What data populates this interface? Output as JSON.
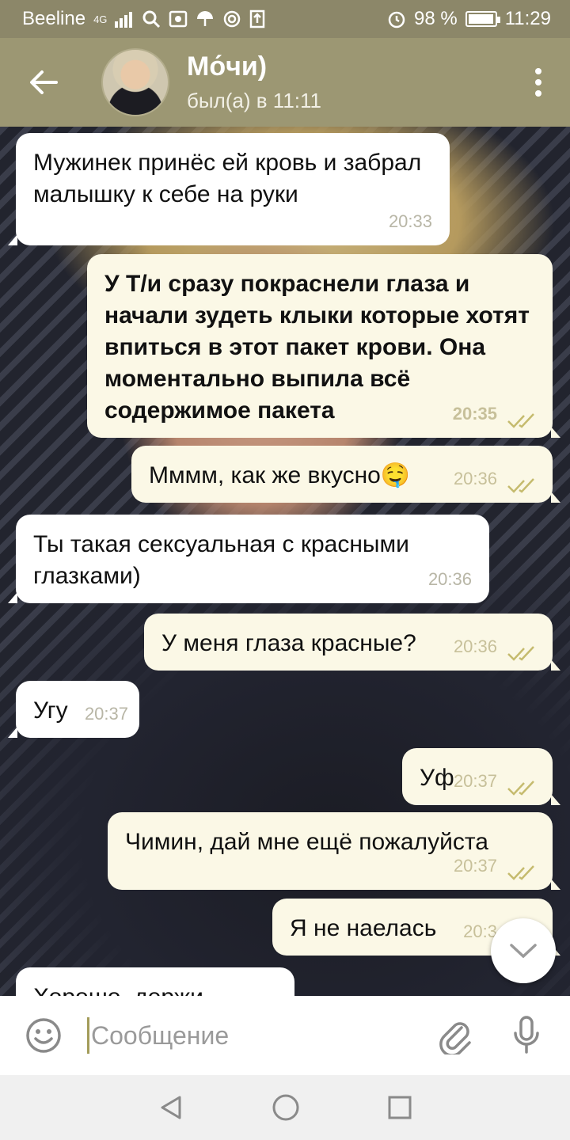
{
  "status_bar": {
    "carrier": "Beeline",
    "network": "4G",
    "battery": "98 %",
    "battery_level": 0.98,
    "time": "11:29"
  },
  "header": {
    "name": "Мо́чи)",
    "status": "был(а) в 11:11"
  },
  "messages": [
    {
      "dir": "in",
      "text": "Мужинек принёс ей кровь и забрал малышку к себе на руки",
      "time": "20:33"
    },
    {
      "dir": "out",
      "text": "У Т/и сразу покраснели глаза и начали зудеть клыки которые хотят впиться в этот пакет крови. Она моментально выпила всё содержимое пакета",
      "time": "20:35"
    },
    {
      "dir": "out",
      "text": "Мммм, как же вкусно🤤",
      "time": "20:36"
    },
    {
      "dir": "in",
      "text": "Ты такая сексуальная с красными глазками)",
      "time": "20:36"
    },
    {
      "dir": "out",
      "text": "У меня глаза красные?",
      "time": "20:36"
    },
    {
      "dir": "in",
      "text": "Угу",
      "time": "20:37"
    },
    {
      "dir": "out",
      "text": "Уф",
      "time": "20:37"
    },
    {
      "dir": "out",
      "text": "Чимин, дай мне ещё пожалуйста",
      "time": "20:37"
    },
    {
      "dir": "out",
      "text": "Я не наелась",
      "time": "20:3"
    },
    {
      "dir": "in",
      "text": "Хорошо, держи",
      "time": ""
    }
  ],
  "input": {
    "placeholder": "Сообщение"
  },
  "colors": {
    "header": "#9c9773",
    "status_bar": "#8c8769",
    "bubble_in": "#ffffff",
    "bubble_out": "#fbf8e6",
    "read_ticks": "#c5bb6e"
  },
  "icons": [
    "back-arrow-icon",
    "more-vert-icon",
    "double-check-icon",
    "chevron-down-icon",
    "emoji-icon",
    "paperclip-icon",
    "microphone-icon",
    "nav-back-icon",
    "nav-home-icon",
    "nav-recents-icon"
  ]
}
